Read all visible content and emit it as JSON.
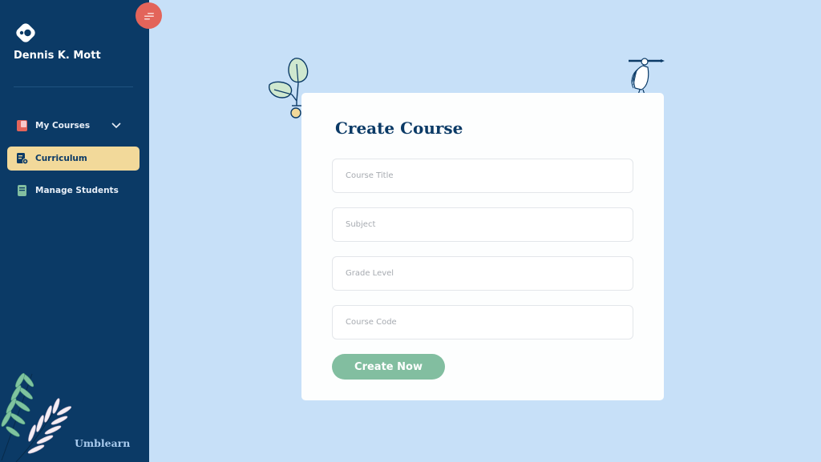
{
  "sidebar": {
    "user_name": "Dennis K. Mott",
    "brand": "Umblearn",
    "items": [
      {
        "label": "My Courses",
        "icon": "courses-icon",
        "expandable": true,
        "active": false
      },
      {
        "label": "Curriculum",
        "icon": "curriculum-icon",
        "active": true
      },
      {
        "label": "Manage Students",
        "icon": "students-icon",
        "active": false
      }
    ]
  },
  "menu_button": {
    "icon": "menu-icon"
  },
  "form": {
    "title": "Create Course",
    "fields": [
      {
        "placeholder": "Course Title",
        "value": ""
      },
      {
        "placeholder": "Subject",
        "value": ""
      },
      {
        "placeholder": "Grade Level",
        "value": ""
      },
      {
        "placeholder": "Course Code",
        "value": ""
      }
    ],
    "submit_label": "Create Now"
  },
  "colors": {
    "sidebar_bg": "#0b3a66",
    "page_bg": "#c7e0f8",
    "active_item_bg": "#f2d99a",
    "accent_red": "#e3645a",
    "button_green": "#82bea0"
  }
}
